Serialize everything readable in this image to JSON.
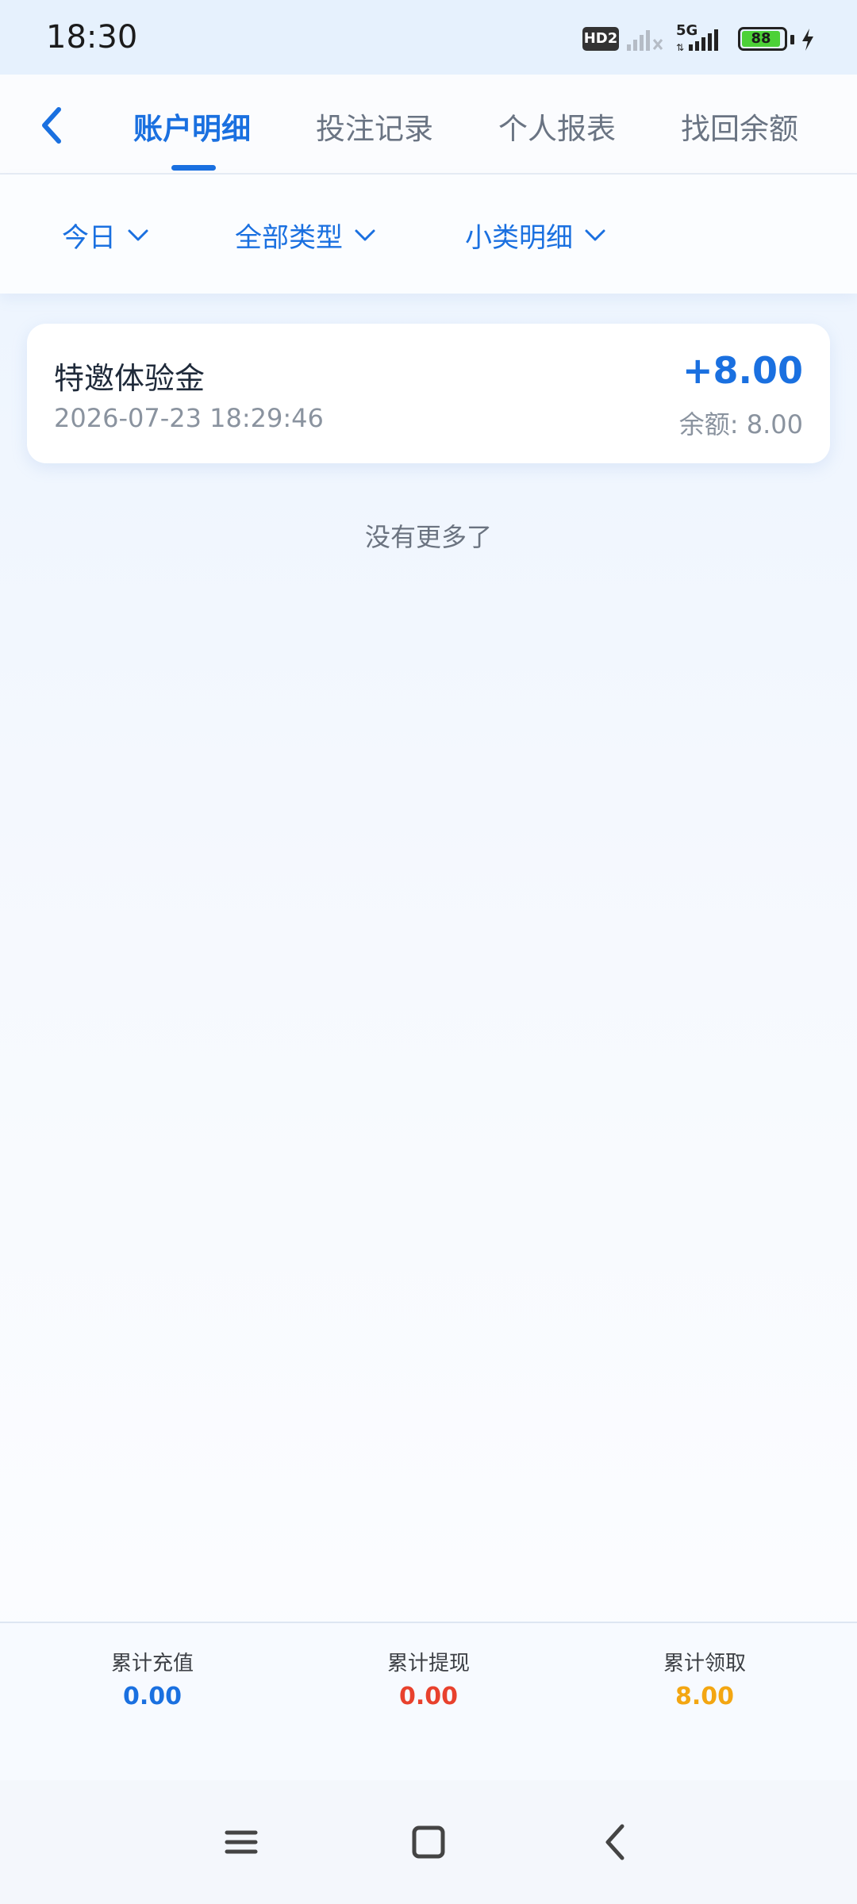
{
  "status": {
    "time": "18:30",
    "network_badge": "HD2",
    "network_type": "5G",
    "battery": "88"
  },
  "header": {
    "tabs": [
      {
        "label": "账户明细",
        "active": true
      },
      {
        "label": "投注记录",
        "active": false
      },
      {
        "label": "个人报表",
        "active": false
      },
      {
        "label": "找回余额",
        "active": false
      }
    ]
  },
  "filters": {
    "date": "今日",
    "type": "全部类型",
    "subtype": "小类明细"
  },
  "records": [
    {
      "title": "特邀体验金",
      "time": "2026-07-23 18:29:46",
      "amount": "+8.00",
      "balance": "余额: 8.00"
    }
  ],
  "list_end_text": "没有更多了",
  "stats": {
    "recharge": {
      "label": "累计充值",
      "value": "0.00",
      "color": "#1a70e0"
    },
    "withdraw": {
      "label": "累计提现",
      "value": "0.00",
      "color": "#e8412d"
    },
    "claim": {
      "label": "累计领取",
      "value": "8.00",
      "color": "#f3a612"
    }
  },
  "colors": {
    "accent": "#1a70e0",
    "text_secondary": "#8a939f"
  }
}
